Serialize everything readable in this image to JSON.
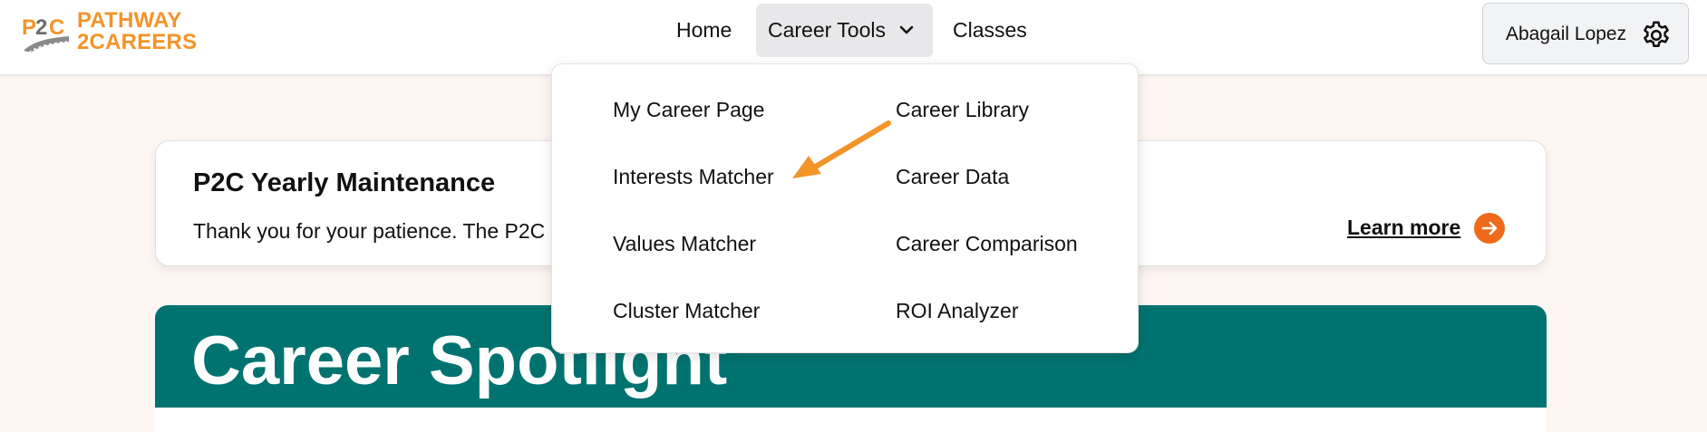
{
  "logo": {
    "line1": "PATHWAY",
    "line2": "2CAREERS",
    "mark_text": "P2C",
    "brand_color": "#f39428"
  },
  "nav": {
    "home": "Home",
    "career_tools": "Career Tools",
    "classes": "Classes"
  },
  "user": {
    "name": "Abagail Lopez"
  },
  "dropdown": {
    "col1": [
      "My Career Page",
      "Interests Matcher",
      "Values Matcher",
      "Cluster Matcher"
    ],
    "col2": [
      "Career Library",
      "Career Data",
      "Career Comparison",
      "ROI Analyzer"
    ]
  },
  "notice": {
    "title": "P2C Yearly Maintenance",
    "text": "Thank you for your patience.  The P2C",
    "link": "Learn more",
    "accent": "#ef6a1a"
  },
  "spotlight": {
    "title": "Career Spotlight",
    "color": "#007370"
  }
}
